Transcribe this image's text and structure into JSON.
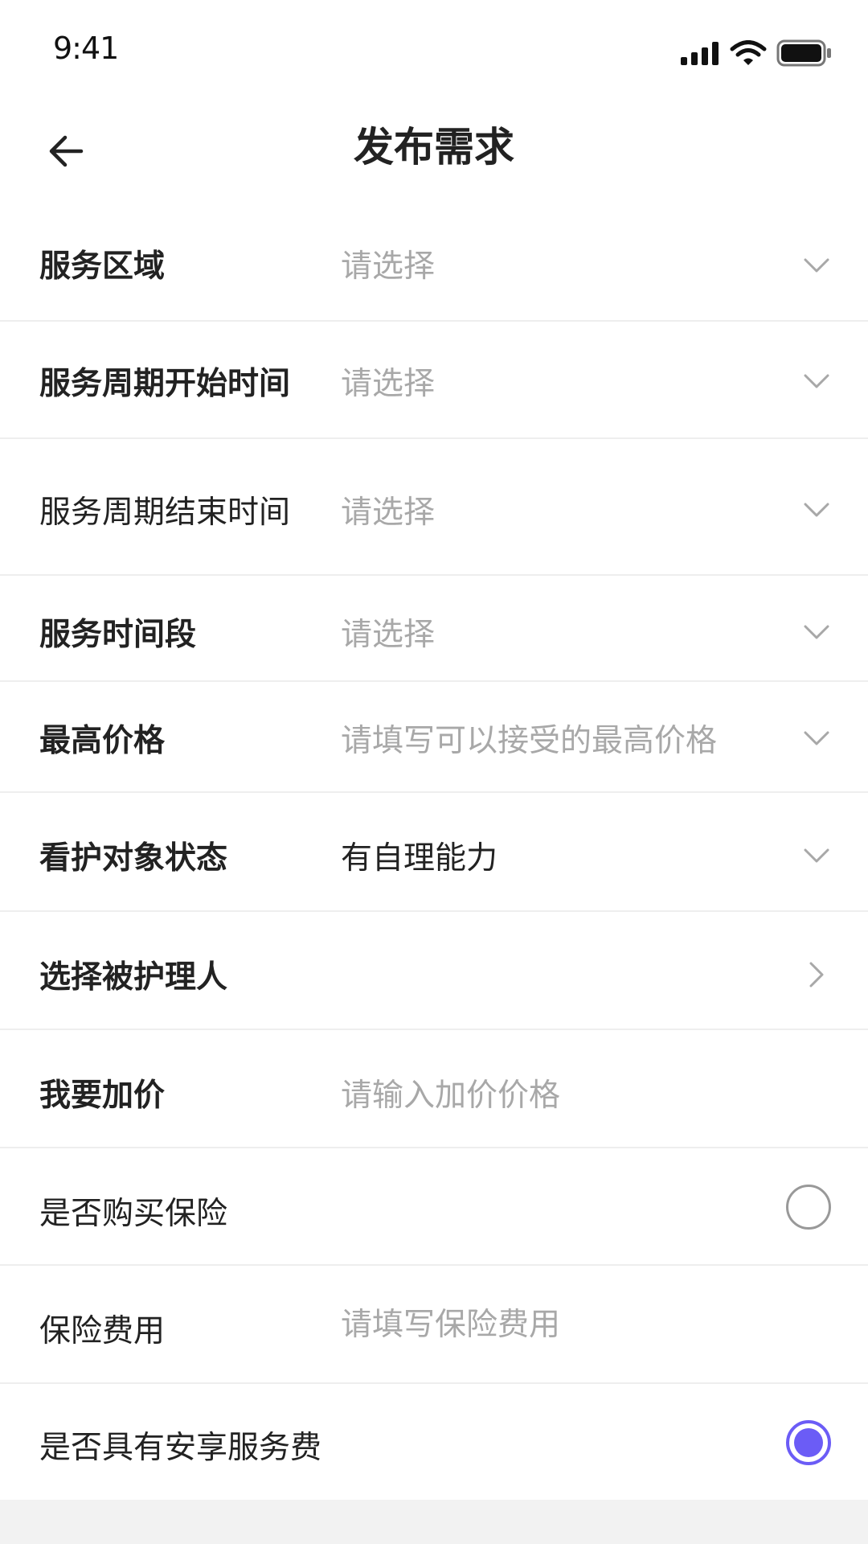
{
  "status_bar": {
    "time": "9:41",
    "icons": [
      "signal-icon",
      "wifi-icon",
      "battery-icon"
    ]
  },
  "header": {
    "back_icon": "arrow-left-icon",
    "title": "发布需求"
  },
  "form": {
    "rows": [
      {
        "label": "服务区域",
        "placeholder": "请选择",
        "value": "",
        "control": "chevron-down-icon"
      },
      {
        "label": "服务周期开始时间",
        "placeholder": "请选择",
        "value": "",
        "control": "chevron-down-icon"
      },
      {
        "label": "服务周期结束时间",
        "placeholder": "请选择",
        "value": "",
        "control": "chevron-down-icon"
      },
      {
        "label": "服务时间段",
        "placeholder": "请选择",
        "value": "",
        "control": "chevron-down-icon"
      },
      {
        "label": "最高价格",
        "placeholder": "请填写可以接受的最高价格",
        "value": "",
        "control": "chevron-down-icon"
      },
      {
        "label": "看护对象状态",
        "placeholder": "",
        "value": "有自理能力",
        "control": "chevron-down-icon"
      },
      {
        "label": "选择被护理人",
        "placeholder": "",
        "value": "",
        "control": "chevron-right-icon"
      },
      {
        "label": "我要加价",
        "placeholder": "请输入加价价格",
        "value": ""
      },
      {
        "label": "是否购买保险",
        "control": "radio",
        "checked": false
      },
      {
        "label": "保险费用",
        "placeholder": "请填写保险费用",
        "value": ""
      },
      {
        "label": "是否具有安享服务费",
        "control": "radio",
        "checked": true
      }
    ]
  },
  "colors": {
    "accent": "#6b5cf6",
    "placeholder": "#a8a8a8",
    "text": "#222222",
    "divider": "#eeeeee"
  }
}
